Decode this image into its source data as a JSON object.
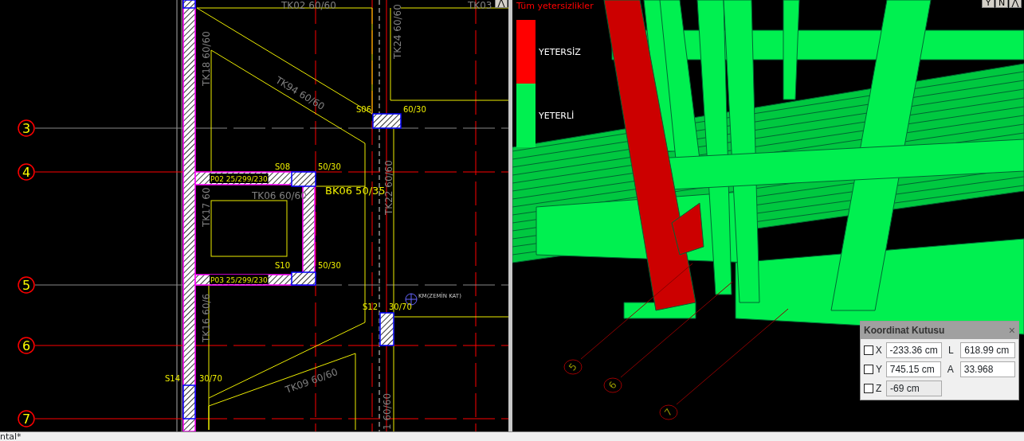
{
  "plan_view": {
    "corner_button": "⋀",
    "axes": [
      {
        "label": "3"
      },
      {
        "label": "4"
      },
      {
        "label": "5"
      },
      {
        "label": "6"
      },
      {
        "label": "7"
      }
    ],
    "labels": [
      {
        "kind": "beam",
        "text": "TK02 60/60"
      },
      {
        "kind": "beam",
        "text": "TK03"
      },
      {
        "kind": "beam",
        "text": "TK24 60/60"
      },
      {
        "kind": "beam",
        "text": "TK18 60/60"
      },
      {
        "kind": "beam",
        "text": "TK94 60/60"
      },
      {
        "kind": "column",
        "text": "S06"
      },
      {
        "kind": "column",
        "text": "60/30"
      },
      {
        "kind": "column",
        "text": "S08"
      },
      {
        "kind": "column",
        "text": "50/30"
      },
      {
        "kind": "wall",
        "text": "P02 25/299/230"
      },
      {
        "kind": "bond",
        "text": "BK06 50/35"
      },
      {
        "kind": "beam",
        "text": "TK06 60/60"
      },
      {
        "kind": "beam",
        "text": "TK17 60"
      },
      {
        "kind": "beam",
        "text": "TK22 60/60"
      },
      {
        "kind": "column",
        "text": "S10"
      },
      {
        "kind": "column",
        "text": "50/30"
      },
      {
        "kind": "wall",
        "text": "P03 25/299/230"
      },
      {
        "kind": "elevation",
        "text": "KM(ZEMİN KAT)"
      },
      {
        "kind": "column",
        "text": "S12"
      },
      {
        "kind": "column",
        "text": "30/70"
      },
      {
        "kind": "beam",
        "text": "TK16 60/6"
      },
      {
        "kind": "column",
        "text": "S14"
      },
      {
        "kind": "column",
        "text": "30/70"
      },
      {
        "kind": "beam",
        "text": "TK09 60/60"
      },
      {
        "kind": "beam",
        "text": "1 60/60"
      }
    ]
  },
  "model_view": {
    "buttons": [
      "Y",
      "N",
      "⋀"
    ],
    "legend": {
      "title": "Tüm yetersizlikler",
      "items": [
        {
          "label": "YETERSİZ",
          "color": "#ff0000"
        },
        {
          "label": "YETERLİ",
          "color": "#00f050"
        }
      ]
    },
    "axes": [
      {
        "label": "5"
      },
      {
        "label": "6"
      },
      {
        "label": "7"
      }
    ]
  },
  "coordinate_box": {
    "title": "Koordinat Kutusu",
    "close": "×",
    "rows": [
      {
        "axis": "X",
        "checked": false,
        "value": "-233.36 cm",
        "disabled": false,
        "extra_label": "L",
        "extra_value": "618.99 cm"
      },
      {
        "axis": "Y",
        "checked": false,
        "value": "745.15 cm",
        "disabled": false,
        "extra_label": "A",
        "extra_value": "33.968"
      },
      {
        "axis": "Z",
        "checked": false,
        "value": "-69 cm",
        "disabled": true
      }
    ]
  },
  "status_bar": {
    "text": "ntal*"
  }
}
